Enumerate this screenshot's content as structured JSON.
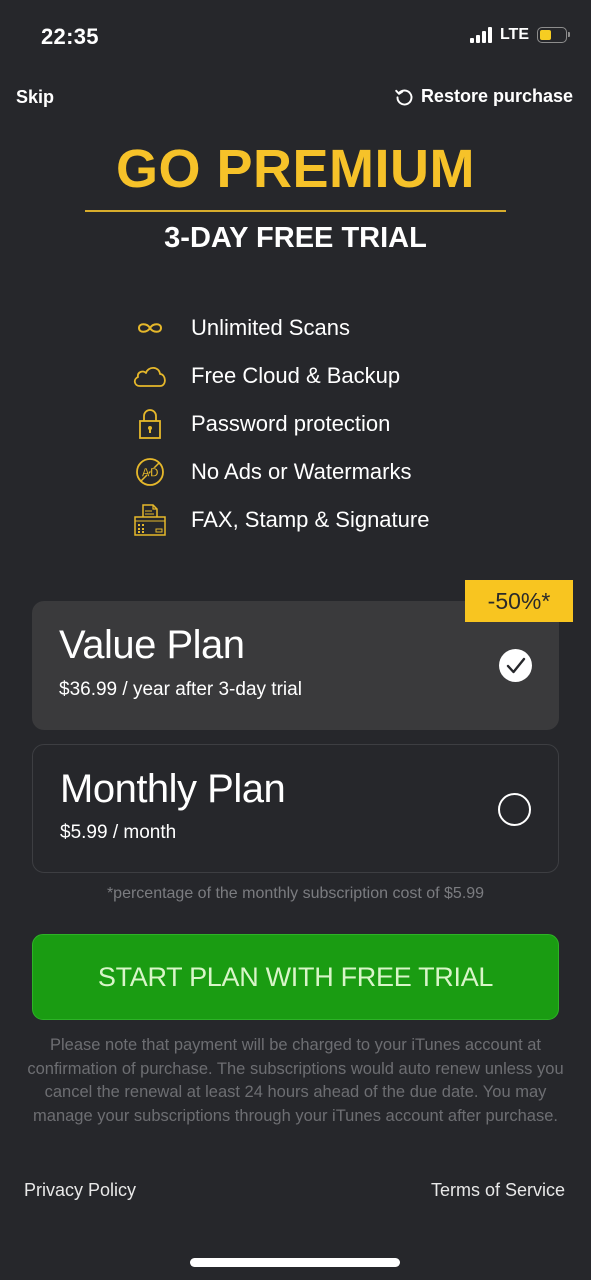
{
  "status_bar": {
    "time": "22:35",
    "network": "LTE",
    "battery_level": 0.45,
    "signal_bars": 4
  },
  "nav": {
    "skip_label": "Skip",
    "restore_label": "Restore purchase",
    "restore_icon": "refresh-icon"
  },
  "header": {
    "title": "GO PREMIUM",
    "subtitle": "3-DAY FREE TRIAL"
  },
  "features": [
    {
      "icon": "infinity-icon",
      "label": "Unlimited Scans"
    },
    {
      "icon": "cloud-icon",
      "label": "Free Cloud & Backup"
    },
    {
      "icon": "lock-icon",
      "label": "Password protection"
    },
    {
      "icon": "no-ads-icon",
      "label": "No Ads or Watermarks"
    },
    {
      "icon": "fax-icon",
      "label": "FAX, Stamp & Signature"
    }
  ],
  "plans": [
    {
      "name": "Value Plan",
      "price": "$36.99 / year after 3-day trial",
      "selected": true,
      "badge": "-50%*"
    },
    {
      "name": "Monthly Plan",
      "price": "$5.99 / month",
      "selected": false
    }
  ],
  "footnote": "*percentage of the monthly subscription cost of $5.99",
  "cta_label": "START PLAN WITH FREE TRIAL",
  "legal_text": "Please note that payment will be charged to your iTunes account at confirmation of purchase. The subscriptions would auto renew unless you cancel the renewal at least 24 hours ahead of the due date. You may manage your subscriptions through your iTunes account after purchase.",
  "links": {
    "privacy": "Privacy Policy",
    "terms": "Terms of Service"
  },
  "colors": {
    "background": "#26272b",
    "accent_yellow": "#f6c229",
    "cta_green": "#1a9c12",
    "selected_card": "#3a3a3c"
  }
}
